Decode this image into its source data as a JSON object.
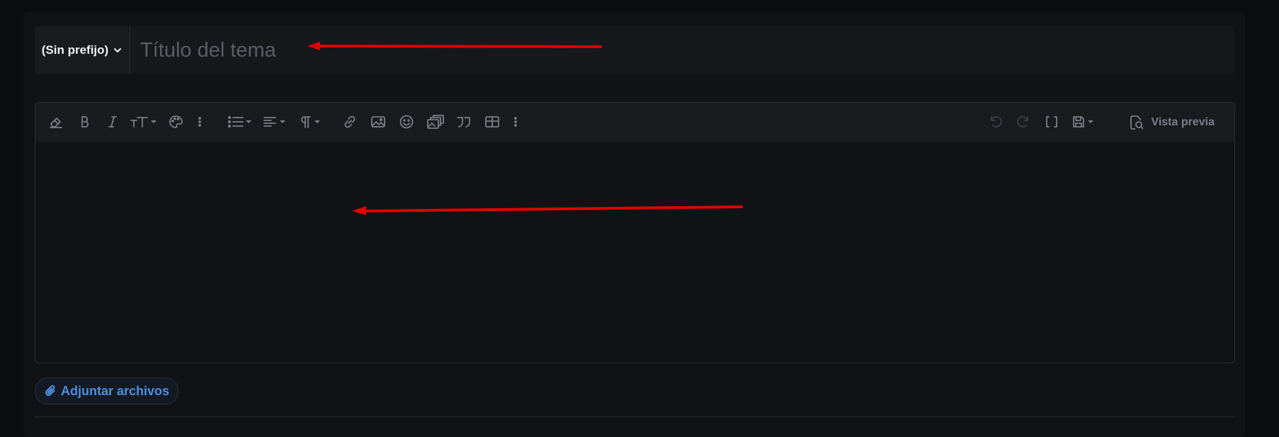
{
  "title_row": {
    "prefix_label": "(Sin prefijo)",
    "title_placeholder": "Título del tema"
  },
  "editor": {
    "toolbar_icons": [
      "eraser-icon",
      "bold-icon",
      "italic-icon",
      "font-size-icon",
      "palette-icon",
      "more-vertical-icon",
      "list-icon",
      "align-icon",
      "paragraph-icon",
      "link-icon",
      "image-icon",
      "emoji-icon",
      "media-gallery-icon",
      "quote-icon",
      "table-icon",
      "more-vertical-icon",
      "undo-icon",
      "redo-icon",
      "bbcode-brackets-icon",
      "save-draft-icon"
    ],
    "preview_label": "Vista previa"
  },
  "attach": {
    "label": "Adjuntar archivos"
  },
  "colors": {
    "accent": "#4c8fe0",
    "annotation_arrow": "#e00000",
    "background": "#0b0c10"
  }
}
